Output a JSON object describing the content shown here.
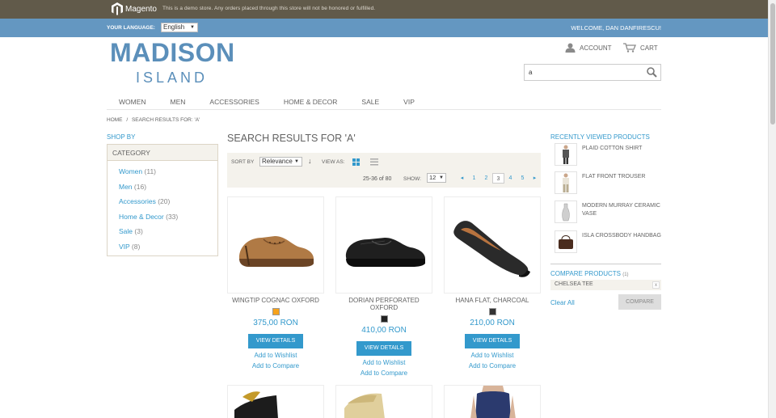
{
  "demo_bar": {
    "logo_text": "Magento",
    "notice": "This is a demo store. Any orders placed through this store will not be honored or fulfilled."
  },
  "header_bar": {
    "language_label": "YOUR LANGUAGE:",
    "language_value": "English",
    "welcome": "WELCOME, DAN DANFIRESCU!"
  },
  "logo": {
    "main": "MADISON",
    "sub": "ISLAND"
  },
  "account": {
    "account_label": "ACCOUNT",
    "cart_label": "CART"
  },
  "search": {
    "value": "a"
  },
  "nav": {
    "items": [
      "WOMEN",
      "MEN",
      "ACCESSORIES",
      "HOME & DECOR",
      "SALE",
      "VIP"
    ]
  },
  "breadcrumb": {
    "home": "HOME",
    "sep": "/",
    "current": "SEARCH RESULTS FOR: 'A'"
  },
  "sidebar": {
    "shop_by": "SHOP BY",
    "category_header": "CATEGORY",
    "categories": [
      {
        "label": "Women",
        "count": "(11)"
      },
      {
        "label": "Men",
        "count": "(16)"
      },
      {
        "label": "Accessories",
        "count": "(20)"
      },
      {
        "label": "Home & Decor",
        "count": "(33)"
      },
      {
        "label": "Sale",
        "count": "(3)"
      },
      {
        "label": "VIP",
        "count": "(8)"
      }
    ]
  },
  "results": {
    "title": "SEARCH RESULTS FOR 'A'",
    "sort_by_label": "SORT BY",
    "sort_value": "Relevance",
    "view_as_label": "VIEW AS:",
    "range": "25-36 of 80",
    "show_label": "SHOW:",
    "show_value": "12",
    "pages": [
      "1",
      "2",
      "3",
      "4",
      "5"
    ],
    "current_page": "3"
  },
  "products": [
    {
      "name": "WINGTIP COGNAC OXFORD",
      "price": "375,00 RON",
      "swatch": "#f7a21b",
      "view": "VIEW DETAILS",
      "wishlist": "Add to Wishlist",
      "compare": "Add to Compare"
    },
    {
      "name": "DORIAN PERFORATED OXFORD",
      "price": "410,00 RON",
      "swatch": "#222222",
      "view": "VIEW DETAILS",
      "wishlist": "Add to Wishlist",
      "compare": "Add to Compare"
    },
    {
      "name": "HANA FLAT, CHARCOAL",
      "price": "210,00 RON",
      "swatch": "#333333",
      "view": "VIEW DETAILS",
      "wishlist": "Add to Wishlist",
      "compare": "Add to Compare"
    }
  ],
  "recently_viewed": {
    "title": "RECENTLY VIEWED PRODUCTS",
    "items": [
      "PLAID COTTON SHIRT",
      "FLAT FRONT TROUSER",
      "MODERN MURRAY CERAMIC VASE",
      "ISLA CROSSBODY HANDBAG"
    ]
  },
  "compare": {
    "title": "COMPARE PRODUCTS",
    "count": "(1)",
    "item": "CHELSEA TEE",
    "remove": "x",
    "clear_all": "Clear All",
    "button": "COMPARE"
  }
}
